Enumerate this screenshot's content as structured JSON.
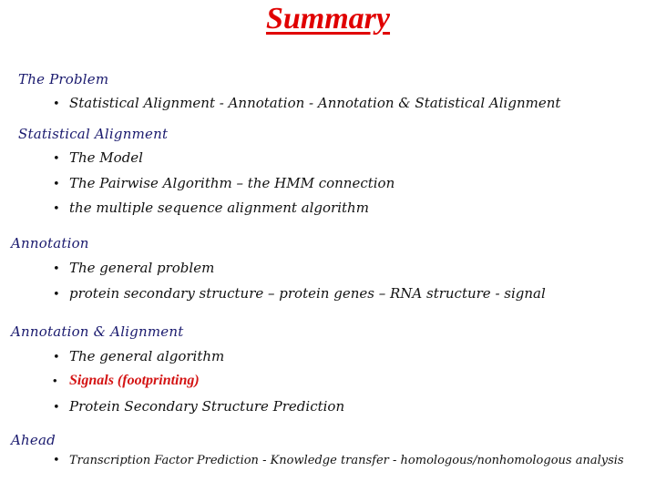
{
  "title": "Summary",
  "sections": [
    {
      "heading": "The Problem",
      "items": [
        "Statistical Alignment -  Annotation  -  Annotation & Statistical Alignment"
      ]
    },
    {
      "heading": "Statistical Alignment",
      "items": [
        "The Model",
        "The Pairwise Algorithm – the HMM connection",
        "the multiple sequence alignment algorithm"
      ]
    },
    {
      "heading": "Annotation",
      "items": [
        "The general problem",
        "protein secondary structure – protein genes – RNA structure - signal"
      ]
    },
    {
      "heading": "Annotation & Alignment",
      "items": [
        "The general algorithm",
        "Signals (footprinting)",
        "Protein Secondary Structure Prediction"
      ]
    },
    {
      "heading": "Ahead",
      "items": [
        "Transcription Factor Prediction - Knowledge transfer  -  homologous/nonhomologous analysis"
      ]
    }
  ],
  "bullet_glyph": "•",
  "colors": {
    "title": "#e00000",
    "heading": "#1a1a6e",
    "highlight": "#d41414"
  }
}
